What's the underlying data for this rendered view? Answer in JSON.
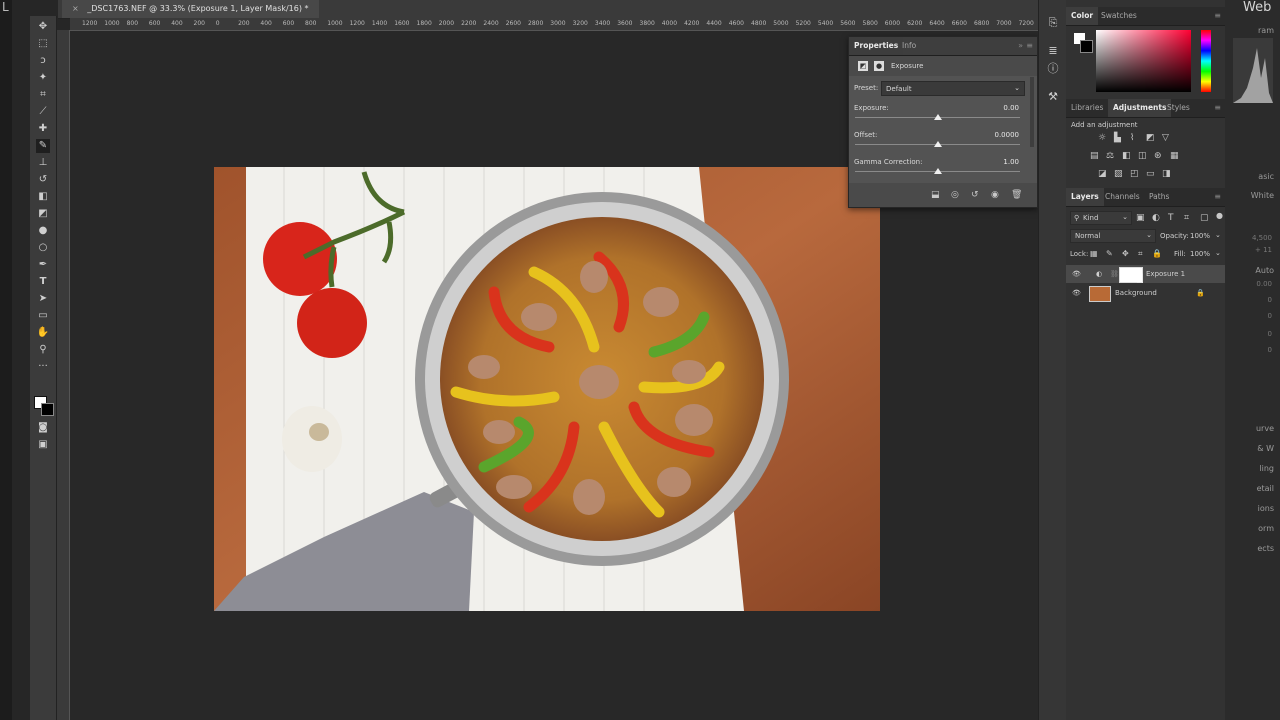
{
  "document": {
    "tab_title": "_DSC1763.NEF @ 33.3% (Exposure 1, Layer Mask/16) *"
  },
  "ruler": {
    "ticks": [
      "1200",
      "1000",
      "800",
      "600",
      "400",
      "200",
      "0",
      "200",
      "400",
      "600",
      "800",
      "1000",
      "1200",
      "1400",
      "1600",
      "1800",
      "2000",
      "2200",
      "2400",
      "2600",
      "2800",
      "3000",
      "3200",
      "3400",
      "3600",
      "3800",
      "4000",
      "4200",
      "4400",
      "4600",
      "4800",
      "5000",
      "5200",
      "5400",
      "5600",
      "5800",
      "6000",
      "6200",
      "6400",
      "6600",
      "6800",
      "7000",
      "7200"
    ]
  },
  "color_panel": {
    "tabs": [
      "Color",
      "Swatches"
    ]
  },
  "adjustments_panel": {
    "tabs": [
      "Libraries",
      "Adjustments",
      "Styles"
    ],
    "add_label": "Add an adjustment"
  },
  "properties_panel": {
    "tabs": [
      "Properties",
      "Info"
    ],
    "adjustment_name": "Exposure",
    "preset_label": "Preset:",
    "preset_value": "Default",
    "sliders": [
      {
        "label": "Exposure:",
        "value": "0.00",
        "position": 0.5
      },
      {
        "label": "Offset:",
        "value": "0.0000",
        "position": 0.5
      },
      {
        "label": "Gamma Correction:",
        "value": "1.00",
        "position": 0.5
      }
    ]
  },
  "layers_panel": {
    "tabs": [
      "Layers",
      "Channels",
      "Paths"
    ],
    "filter_kind": "Kind",
    "blend_mode": "Normal",
    "opacity_label": "Opacity:",
    "opacity_value": "100%",
    "lock_label": "Lock:",
    "fill_label": "Fill:",
    "fill_value": "100%",
    "layers": [
      {
        "name": "Exposure 1",
        "selected": true
      },
      {
        "name": "Background",
        "selected": false
      }
    ]
  },
  "lightroom": {
    "top_right_label": "Web",
    "side_labels": [
      "ram",
      "asic",
      "White",
      "Auto",
      "urve",
      "& W",
      "ling",
      "etail",
      "ions",
      "orm",
      "ects"
    ],
    "side_numbers": [
      "4,500",
      "+ 11",
      "0.00",
      "0",
      "0",
      "0",
      "0"
    ]
  },
  "colors": {
    "canvas": "#282828",
    "panel": "#323232",
    "properties_bg": "#535353",
    "selection": "#4a4a4a"
  }
}
